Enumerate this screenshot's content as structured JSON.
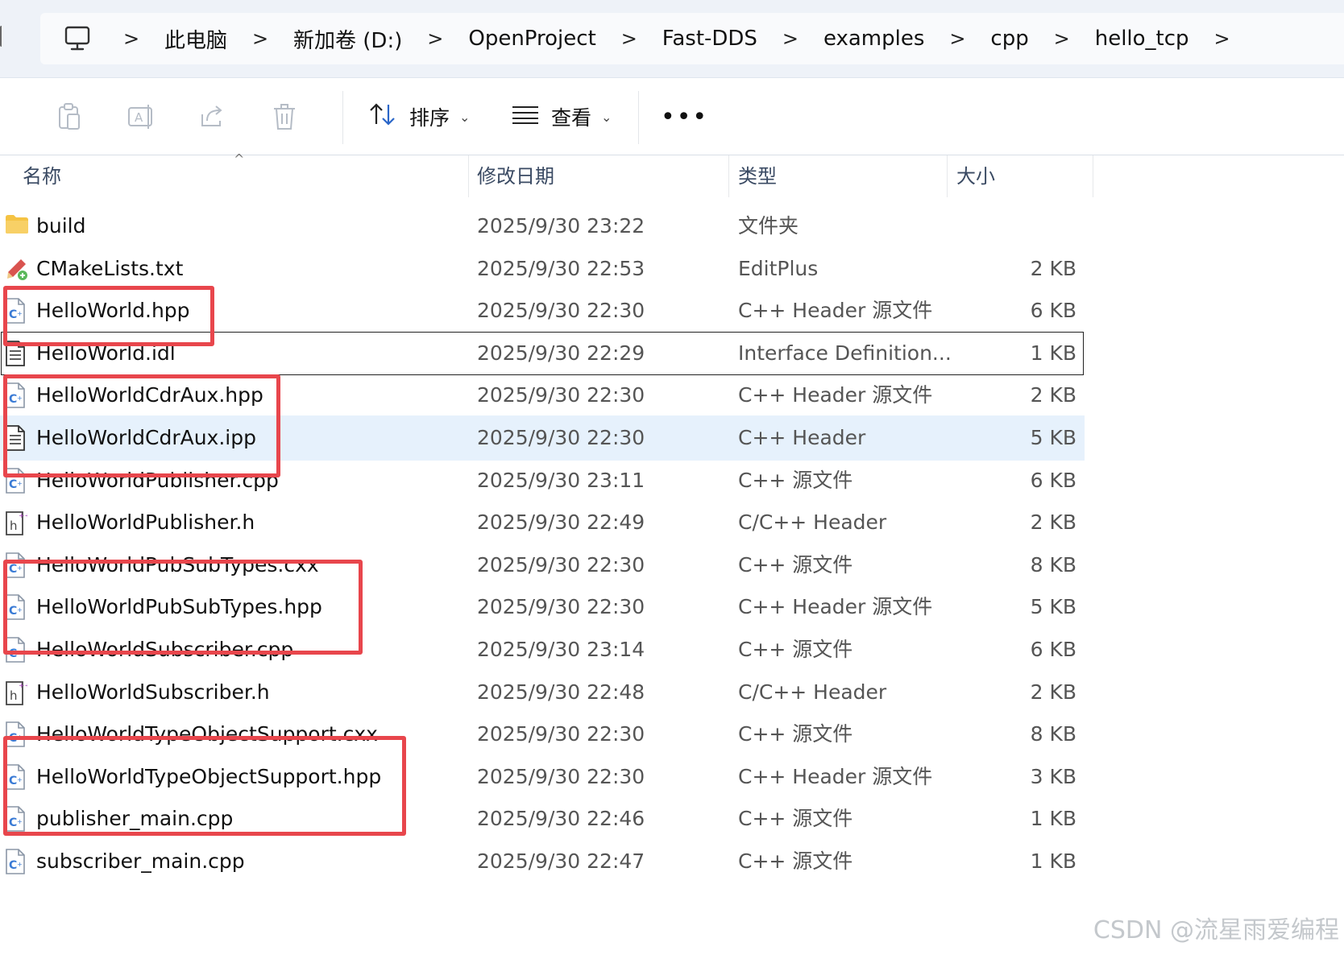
{
  "breadcrumbs": [
    "此电脑",
    "新加卷 (D:)",
    "OpenProject",
    "Fast-DDS",
    "examples",
    "cpp",
    "hello_tcp"
  ],
  "toolbar": {
    "sort_label": "排序",
    "view_label": "查看",
    "more_label": "•••"
  },
  "columns": {
    "name": "名称",
    "date": "修改日期",
    "type": "类型",
    "size": "大小"
  },
  "files": [
    {
      "name": "build",
      "date": "2025/9/30 23:22",
      "type": "文件夹",
      "size": "",
      "icon": "folder-icon"
    },
    {
      "name": "CMakeLists.txt",
      "date": "2025/9/30 22:53",
      "type": "EditPlus",
      "size": "2 KB",
      "icon": "editplus-file-icon"
    },
    {
      "name": "HelloWorld.hpp",
      "date": "2025/9/30 22:30",
      "type": "C++ Header 源文件",
      "size": "6 KB",
      "icon": "cpp-file-icon"
    },
    {
      "name": "HelloWorld.idl",
      "date": "2025/9/30 22:29",
      "type": "Interface Definition...",
      "size": "1 KB",
      "icon": "text-file-icon"
    },
    {
      "name": "HelloWorldCdrAux.hpp",
      "date": "2025/9/30 22:30",
      "type": "C++ Header 源文件",
      "size": "2 KB",
      "icon": "cpp-file-icon"
    },
    {
      "name": "HelloWorldCdrAux.ipp",
      "date": "2025/9/30 22:30",
      "type": "C++ Header",
      "size": "5 KB",
      "icon": "text-file-icon"
    },
    {
      "name": "HelloWorldPublisher.cpp",
      "date": "2025/9/30 23:11",
      "type": "C++ 源文件",
      "size": "6 KB",
      "icon": "cpp-file-icon"
    },
    {
      "name": "HelloWorldPublisher.h",
      "date": "2025/9/30 22:49",
      "type": "C/C++ Header",
      "size": "2 KB",
      "icon": "h-file-icon"
    },
    {
      "name": "HelloWorldPubSubTypes.cxx",
      "date": "2025/9/30 22:30",
      "type": "C++ 源文件",
      "size": "8 KB",
      "icon": "cpp-file-icon"
    },
    {
      "name": "HelloWorldPubSubTypes.hpp",
      "date": "2025/9/30 22:30",
      "type": "C++ Header 源文件",
      "size": "5 KB",
      "icon": "cpp-file-icon"
    },
    {
      "name": "HelloWorldSubscriber.cpp",
      "date": "2025/9/30 23:14",
      "type": "C++ 源文件",
      "size": "6 KB",
      "icon": "cpp-file-icon"
    },
    {
      "name": "HelloWorldSubscriber.h",
      "date": "2025/9/30 22:48",
      "type": "C/C++ Header",
      "size": "2 KB",
      "icon": "h-file-icon"
    },
    {
      "name": "HelloWorldTypeObjectSupport.cxx",
      "date": "2025/9/30 22:30",
      "type": "C++ 源文件",
      "size": "8 KB",
      "icon": "cpp-file-icon"
    },
    {
      "name": "HelloWorldTypeObjectSupport.hpp",
      "date": "2025/9/30 22:30",
      "type": "C++ Header 源文件",
      "size": "3 KB",
      "icon": "cpp-file-icon"
    },
    {
      "name": "publisher_main.cpp",
      "date": "2025/9/30 22:46",
      "type": "C++ 源文件",
      "size": "1 KB",
      "icon": "cpp-file-icon"
    },
    {
      "name": "subscriber_main.cpp",
      "date": "2025/9/30 22:47",
      "type": "C++ 源文件",
      "size": "1 KB",
      "icon": "cpp-file-icon"
    }
  ],
  "watermark": "CSDN @流星雨爱编程",
  "colors": {
    "annotation_red": "#e8464c",
    "hover_row": "#e6f1fc",
    "folder_yellow": "#f5c343",
    "cpp_blue": "#3a7bd5"
  }
}
